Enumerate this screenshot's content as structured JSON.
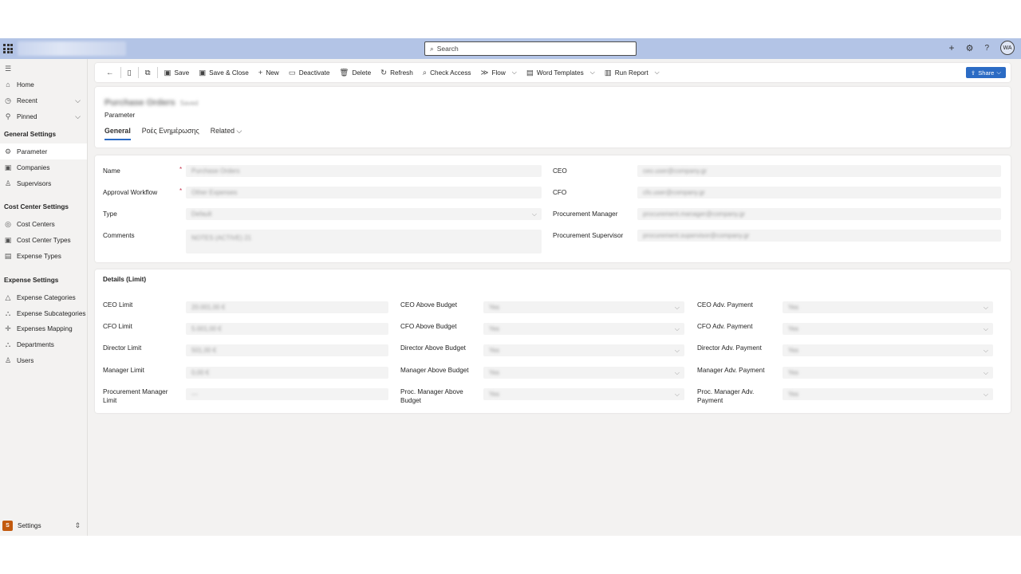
{
  "topbar": {
    "search_placeholder": "Search",
    "avatar_initials": "WA",
    "add_glyph": "+",
    "settings_glyph": "⚙",
    "help_glyph": "?"
  },
  "sidebar": {
    "home": "Home",
    "recent": "Recent",
    "pinned": "Pinned",
    "group_general": "General Settings",
    "parameter": "Parameter",
    "companies": "Companies",
    "supervisors": "Supervisors",
    "group_cost_center": "Cost Center Settings",
    "cost_centers": "Cost Centers",
    "cost_center_types": "Cost Center Types",
    "expense_types": "Expense Types",
    "group_expense": "Expense Settings",
    "expense_categories": "Expense Categories",
    "expense_subcategories": "Expense Subcategories",
    "expenses_mapping": "Expenses Mapping",
    "departments": "Departments",
    "users": "Users",
    "area_badge": "S",
    "area_name": "Settings"
  },
  "commands": {
    "save": "Save",
    "save_close": "Save & Close",
    "new": "New",
    "deactivate": "Deactivate",
    "delete": "Delete",
    "refresh": "Refresh",
    "check_access": "Check Access",
    "flow": "Flow",
    "word_templates": "Word Templates",
    "run_report": "Run Report",
    "share": "Share"
  },
  "header": {
    "record_name": "Purchase Orders",
    "record_status": "Saved",
    "entity": "Parameter",
    "tabs": [
      "General",
      "Ροές Ενημέρωσης",
      "Related"
    ]
  },
  "general": {
    "name_label": "Name",
    "name_value": "Purchase Orders",
    "workflow_label": "Approval Workflow",
    "workflow_value": "Other Expenses",
    "type_label": "Type",
    "type_value": "Default",
    "comments_label": "Comments",
    "comments_value": "NOTES (ACTIVE) 21",
    "ceo_label": "CEO",
    "ceo_value": "ceo.user@company.gr",
    "cfo_label": "CFO",
    "cfo_value": "cfo.user@company.gr",
    "pm_label": "Procurement Manager",
    "pm_value": "procurement.manager@company.gr",
    "ps_label": "Procurement Supervisor",
    "ps_value": "procurement.supervisor@company.gr"
  },
  "details": {
    "title": "Details (Limit)",
    "rows": [
      {
        "l1": "CEO Limit",
        "v1": "20.001,00 €",
        "l2": "CEO Above Budget",
        "v2": "Yes",
        "l3": "CEO Adv. Payment",
        "v3": "Yes"
      },
      {
        "l1": "CFO Limit",
        "v1": "5.001,00 €",
        "l2": "CFO Above Budget",
        "v2": "Yes",
        "l3": "CFO Adv. Payment",
        "v3": "Yes"
      },
      {
        "l1": "Director Limit",
        "v1": "501,00 €",
        "l2": "Director Above Budget",
        "v2": "Yes",
        "l3": "Director Adv. Payment",
        "v3": "Yes"
      },
      {
        "l1": "Manager Limit",
        "v1": "0,00 €",
        "l2": "Manager Above Budget",
        "v2": "Yes",
        "l3": "Manager Adv. Payment",
        "v3": "Yes"
      },
      {
        "l1": "Procurement Manager Limit",
        "v1": "---",
        "l2": "Proc. Manager Above Budget",
        "v2": "Yes",
        "l3": "Proc. Manager Adv. Payment",
        "v3": "Yes"
      }
    ]
  },
  "icons": {
    "waffle": "app-launcher-icon",
    "search": "search-icon",
    "back": "back-arrow-icon"
  }
}
